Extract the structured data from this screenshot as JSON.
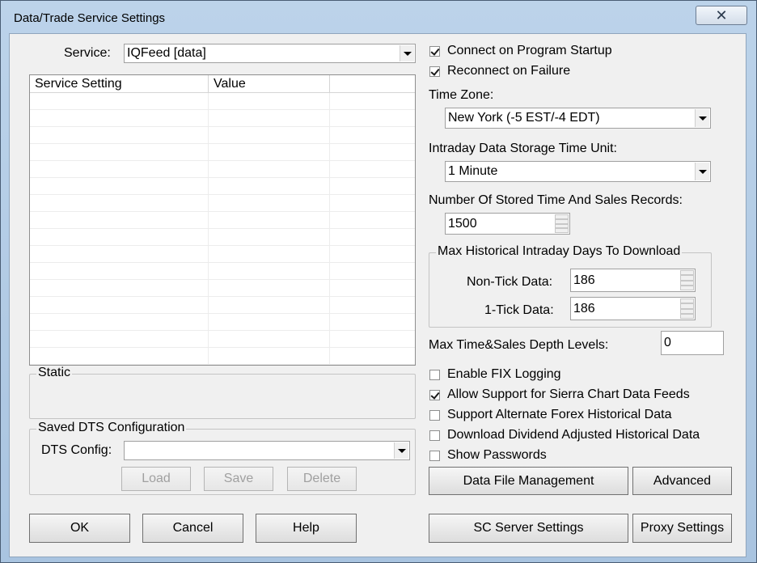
{
  "window": {
    "title": "Data/Trade Service Settings",
    "close_symbol": "✕"
  },
  "service": {
    "label": "Service:",
    "value": "IQFeed    [data]"
  },
  "list": {
    "columns": [
      "Service Setting",
      "Value",
      ""
    ],
    "row_count": 16
  },
  "static_group": {
    "title": "Static"
  },
  "dts": {
    "group_title": "Saved DTS Configuration",
    "config_label": "DTS Config:",
    "config_value": "",
    "load": "Load",
    "save": "Save",
    "delete": "Delete"
  },
  "checks": {
    "connect_startup": {
      "label": "Connect on Program Startup",
      "checked": true
    },
    "reconnect_failure": {
      "label": "Reconnect on Failure",
      "checked": true
    },
    "enable_fix": {
      "label": "Enable FIX Logging",
      "checked": false
    },
    "allow_sc_feeds": {
      "label": "Allow Support for Sierra Chart Data Feeds",
      "checked": true
    },
    "alt_forex": {
      "label": "Support Alternate Forex Historical Data",
      "checked": false
    },
    "dividend": {
      "label": "Download Dividend Adjusted Historical Data",
      "checked": false
    },
    "show_passwords": {
      "label": "Show Passwords",
      "checked": false
    }
  },
  "timezone": {
    "label": "Time Zone:",
    "value": "New York (-5 EST/-4 EDT)"
  },
  "storage_unit": {
    "label": "Intraday Data Storage Time Unit:",
    "value": "1 Minute"
  },
  "stored_records": {
    "label": "Number Of Stored Time And Sales Records:",
    "value": "1500"
  },
  "max_hist": {
    "group_title": "Max Historical Intraday Days To Download",
    "non_tick_label": "Non-Tick Data:",
    "non_tick_value": "186",
    "one_tick_label": "1-Tick Data:",
    "one_tick_value": "186"
  },
  "depth": {
    "label": "Max Time&Sales Depth Levels:",
    "value": "0"
  },
  "buttons": {
    "data_file_mgmt": "Data File Management",
    "advanced": "Advanced",
    "ok": "OK",
    "cancel": "Cancel",
    "help": "Help",
    "sc_server": "SC Server Settings",
    "proxy": "Proxy Settings"
  }
}
